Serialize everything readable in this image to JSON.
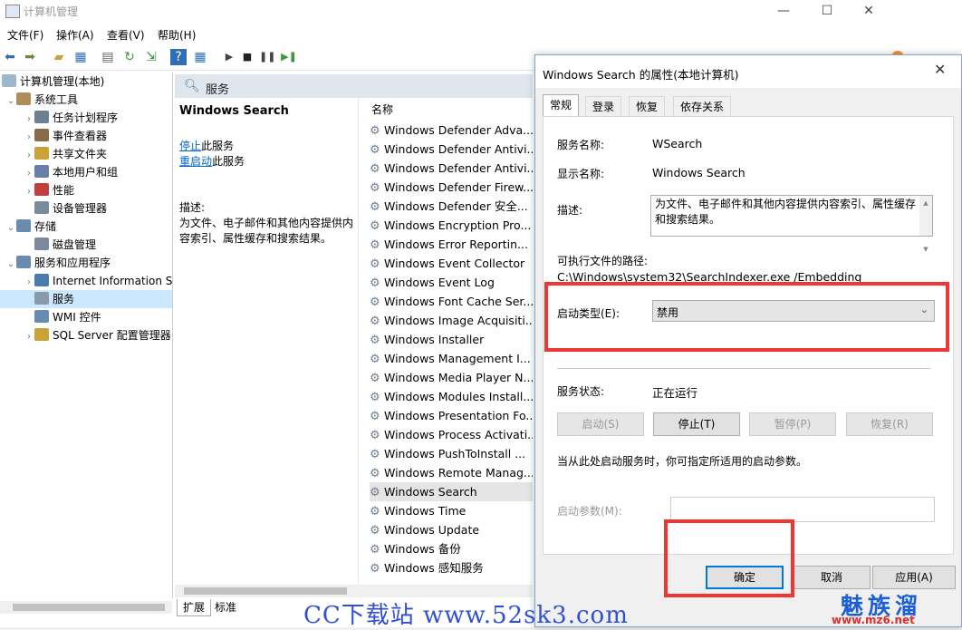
{
  "window": {
    "title": "计算机管理",
    "minimize": "—",
    "maximize": "☐",
    "close": "✕"
  },
  "menu": [
    "文件(F)",
    "操作(A)",
    "查看(V)",
    "帮助(H)"
  ],
  "toolbar_icons": [
    "back-arrow-icon",
    "forward-arrow-icon",
    "up-folder-icon",
    "console-tree-icon",
    "properties-icon",
    "refresh-icon",
    "export-list-icon",
    "help-icon",
    "show-hide-icon",
    "play-icon",
    "stop-icon",
    "pause-icon",
    "restart-icon"
  ],
  "tree": {
    "root": "计算机管理(本地)",
    "items": [
      {
        "label": "系统工具",
        "indent": 0,
        "arrow": "⌄"
      },
      {
        "label": "任务计划程序",
        "indent": 1,
        "arrow": "›"
      },
      {
        "label": "事件查看器",
        "indent": 1,
        "arrow": "›"
      },
      {
        "label": "共享文件夹",
        "indent": 1,
        "arrow": "›"
      },
      {
        "label": "本地用户和组",
        "indent": 1,
        "arrow": "›"
      },
      {
        "label": "性能",
        "indent": 1,
        "arrow": "›"
      },
      {
        "label": "设备管理器",
        "indent": 1,
        "arrow": ""
      },
      {
        "label": "存储",
        "indent": 0,
        "arrow": "⌄"
      },
      {
        "label": "磁盘管理",
        "indent": 1,
        "arrow": ""
      },
      {
        "label": "服务和应用程序",
        "indent": 0,
        "arrow": "⌄"
      },
      {
        "label": "Internet Information S",
        "indent": 1,
        "arrow": "›"
      },
      {
        "label": "服务",
        "indent": 1,
        "arrow": ""
      },
      {
        "label": "WMI 控件",
        "indent": 1,
        "arrow": ""
      },
      {
        "label": "SQL Server 配置管理器",
        "indent": 1,
        "arrow": "›"
      }
    ]
  },
  "services_pane": {
    "header": "服务",
    "selected_name": "Windows Search",
    "stop_link": "停止",
    "stop_suffix": "此服务",
    "restart_link": "重启动",
    "restart_suffix": "此服务",
    "desc_label": "描述:",
    "desc_line1": "为文件、电子邮件和其他内容提供内",
    "desc_line2": "容索引、属性缓存和搜索结果。",
    "column_name": "名称",
    "rows": [
      "Windows Defender Adva...",
      "Windows Defender Antivi...",
      "Windows Defender Antivi...",
      "Windows Defender Firew...",
      "Windows Defender 安全...",
      "Windows Encryption Pro...",
      "Windows Error Reportin...",
      "Windows Event Collector",
      "Windows Event Log",
      "Windows Font Cache Ser...",
      "Windows Image Acquisiti...",
      "Windows Installer",
      "Windows Management I...",
      "Windows Media Player N...",
      "Windows Modules Install...",
      "Windows Presentation Fo...",
      "Windows Process Activati...",
      "Windows PushToInstall ...",
      "Windows Remote Manag...",
      "Windows Search",
      "Windows Time",
      "Windows Update",
      "Windows 备份",
      "Windows 感知服务"
    ],
    "selected_index": 19,
    "tabs": [
      "扩展",
      "标准"
    ]
  },
  "dialog": {
    "title": "Windows Search 的属性(本地计算机)",
    "close": "✕",
    "tabs": [
      "常规",
      "登录",
      "恢复",
      "依存关系"
    ],
    "service_name_label": "服务名称:",
    "service_name": "WSearch",
    "display_name_label": "显示名称:",
    "display_name": "Windows Search",
    "description_label": "描述:",
    "description_line1": "为文件、电子邮件和其他内容提供内容索引、属性缓存",
    "description_line2": "和搜索结果。",
    "path_label": "可执行文件的路径:",
    "path": "C:\\Windows\\system32\\SearchIndexer.exe /Embedding",
    "startup_type_label": "启动类型(E):",
    "startup_type": "禁用",
    "status_label": "服务状态:",
    "status": "正在运行",
    "start_btn": "启动(S)",
    "stop_btn": "停止(T)",
    "pause_btn": "暂停(P)",
    "resume_btn": "恢复(R)",
    "hint": "当从此处启动服务时，你可指定所适用的启动参数。",
    "param_label": "启动参数(M):",
    "param_value": "",
    "ok_btn": "确定",
    "cancel_btn": "取消",
    "apply_btn": "应用(A)"
  },
  "watermark": {
    "left": "CC下载站 www.52sk3.com",
    "right": "魅族溜",
    "right_url": "www.mz6.net"
  },
  "highlight_color": "#f03535"
}
